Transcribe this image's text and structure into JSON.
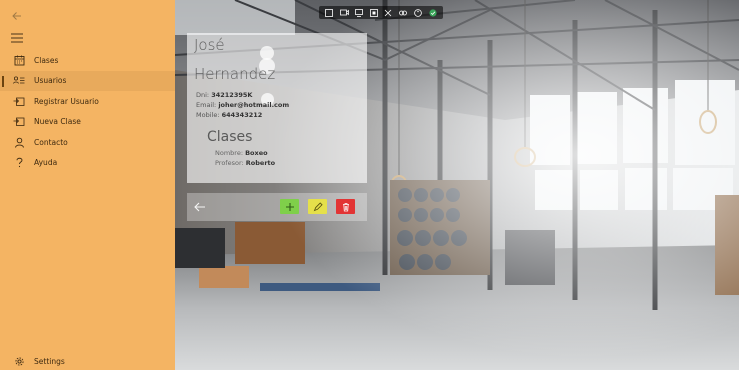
{
  "nav": {
    "back_icon": "arrow-left-icon",
    "menu_icon": "hamburger-icon",
    "items": [
      {
        "label": "Clases",
        "icon": "calendar-icon",
        "active": false
      },
      {
        "label": "Usuarios",
        "icon": "people-list-icon",
        "active": true
      },
      {
        "label": "Registrar Usuario",
        "icon": "register-icon",
        "active": false
      },
      {
        "label": "Nueva Clase",
        "icon": "register-icon",
        "active": false
      },
      {
        "label": "Contacto",
        "icon": "person-icon",
        "active": false
      },
      {
        "label": "Ayuda",
        "icon": "question-icon",
        "active": false
      }
    ],
    "settings": {
      "label": "Settings",
      "icon": "gear-icon"
    }
  },
  "user": {
    "first_name": "José",
    "last_name": "Hernandez",
    "dni_label": "Dni:",
    "dni": "34212395K",
    "email_label": "Email:",
    "email": "joher@hotmail.com",
    "mobile_label": "Mobile:",
    "mobile": "644343212"
  },
  "classes": {
    "title": "Clases",
    "name_label": "Nombre:",
    "name": "Boxeo",
    "teacher_label": "Profesor:",
    "teacher": "Roberto"
  },
  "toolbar": {
    "back_icon": "arrow-left-icon",
    "add_icon": "plus-icon",
    "edit_icon": "pencil-icon",
    "delete_icon": "trash-icon"
  },
  "status_bar": {
    "icons": [
      "screenshot-icon",
      "camera-icon",
      "cast-icon",
      "window-icon",
      "tools-icon",
      "brightness-icon",
      "accessibility-icon",
      "check-icon"
    ]
  },
  "colors": {
    "sidebar": "#f4b463",
    "add": "#7fcf4a",
    "edit": "#e5e04a",
    "delete": "#e23434"
  }
}
